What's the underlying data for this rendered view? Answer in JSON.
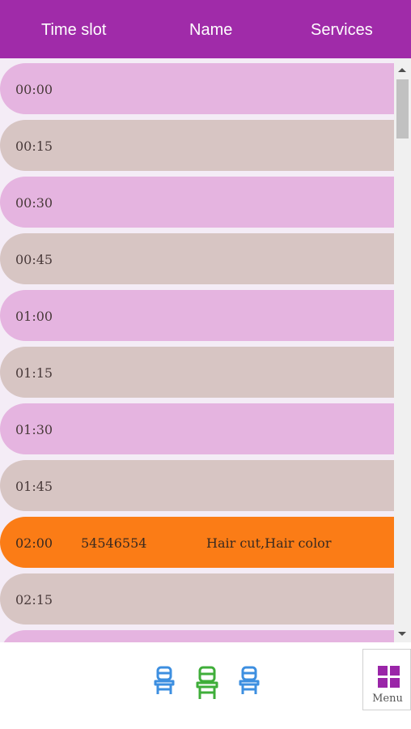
{
  "header": {
    "col_time": "Time slot",
    "col_name": "Name",
    "col_services": "Services"
  },
  "slots": [
    {
      "time": "00:00",
      "name": "",
      "services": ""
    },
    {
      "time": "00:15",
      "name": "",
      "services": ""
    },
    {
      "time": "00:30",
      "name": "",
      "services": ""
    },
    {
      "time": "00:45",
      "name": "",
      "services": ""
    },
    {
      "time": "01:00",
      "name": "",
      "services": ""
    },
    {
      "time": "01:15",
      "name": "",
      "services": ""
    },
    {
      "time": "01:30",
      "name": "",
      "services": ""
    },
    {
      "time": "01:45",
      "name": "",
      "services": ""
    },
    {
      "time": "02:00",
      "name": "54546554",
      "services": "Hair cut,Hair color",
      "booked": true
    },
    {
      "time": "02:15",
      "name": "",
      "services": ""
    },
    {
      "time": "",
      "name": "",
      "services": ""
    }
  ],
  "bottom": {
    "chairs": [
      {
        "icon": "chair-icon",
        "color": "#3d8fe0"
      },
      {
        "icon": "chair-icon",
        "color": "#3fae3a"
      },
      {
        "icon": "chair-icon",
        "color": "#3d8fe0"
      }
    ],
    "menu_label": "Menu",
    "menu_color": "#9a25a8"
  },
  "colors": {
    "header": "#a02ba9",
    "row_pink": "#e5b4e0",
    "row_beige": "#d7c5c3",
    "row_booked": "#fb7c16"
  }
}
